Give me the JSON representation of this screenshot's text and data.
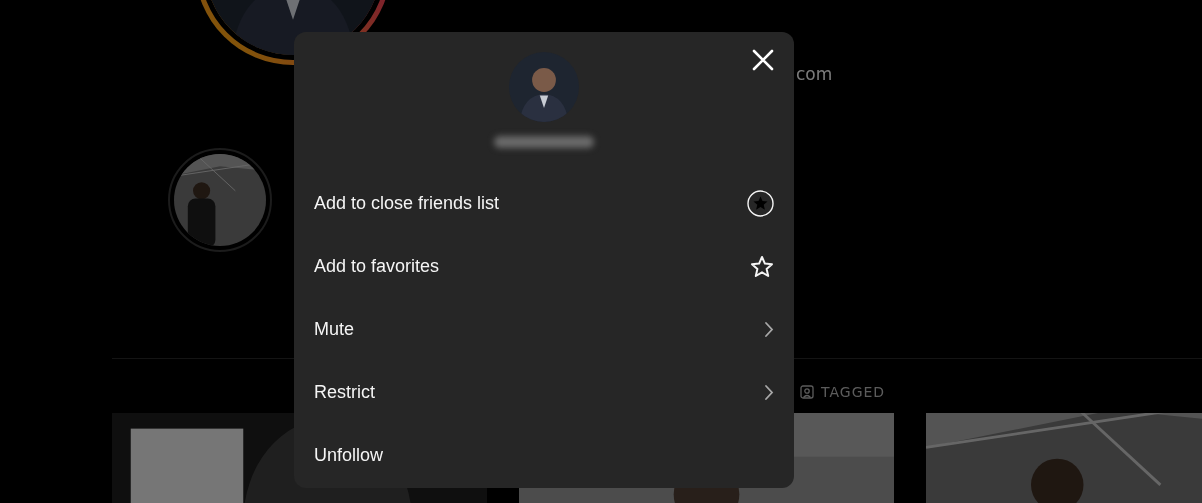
{
  "background": {
    "website_fragment": "com",
    "tabs": [
      {
        "label": "TAGGED",
        "selected": false
      }
    ]
  },
  "dialog": {
    "items": [
      {
        "label": "Add to close friends list",
        "kind": "close-friends"
      },
      {
        "label": "Add to favorites",
        "kind": "favorite"
      },
      {
        "label": "Mute",
        "kind": "submenu"
      },
      {
        "label": "Restrict",
        "kind": "submenu"
      },
      {
        "label": "Unfollow",
        "kind": "plain"
      }
    ]
  }
}
